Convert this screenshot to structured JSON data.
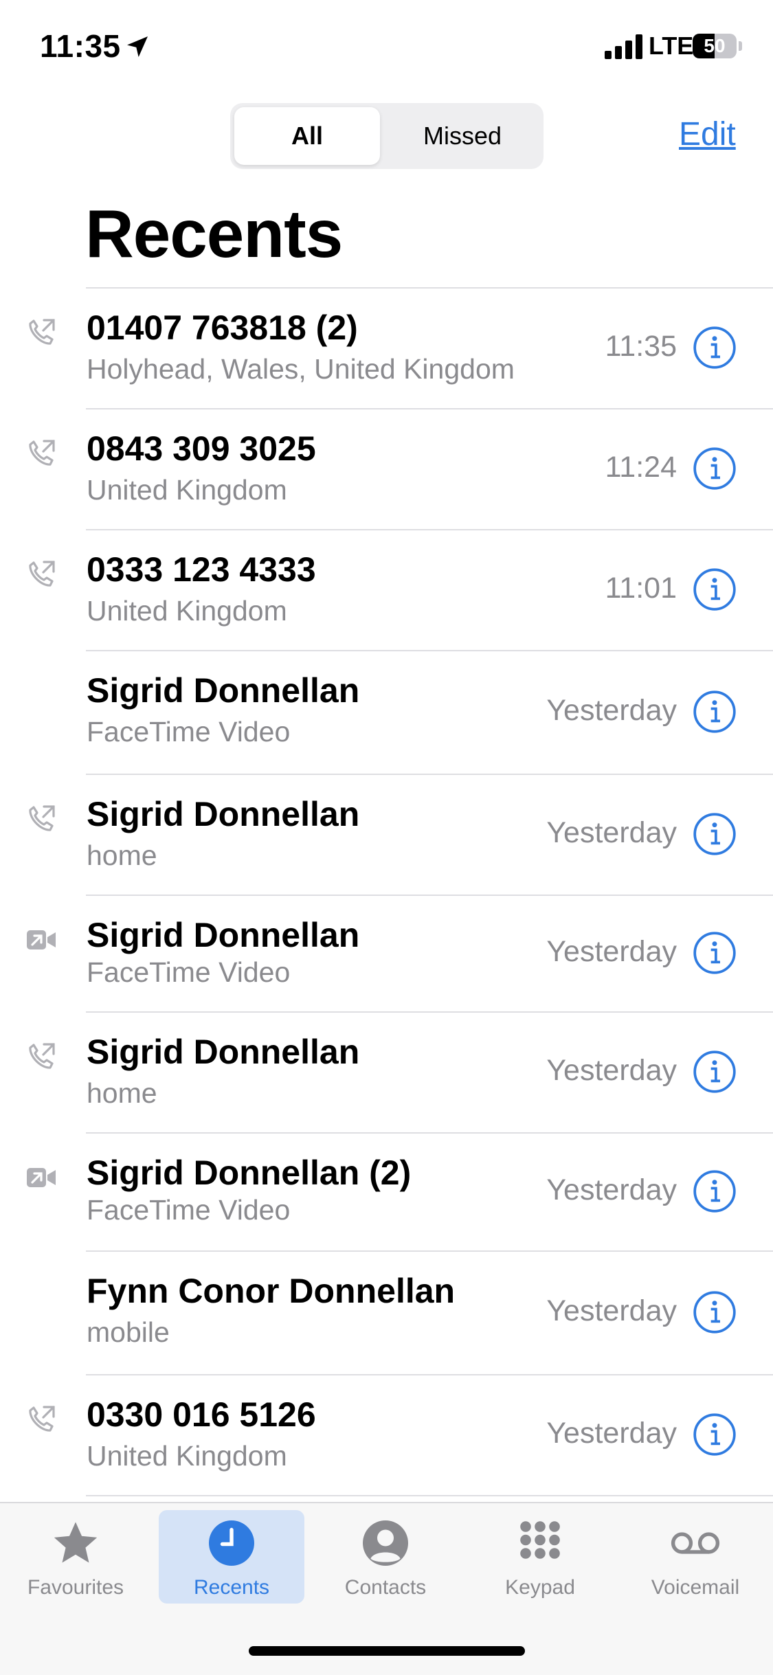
{
  "status_bar": {
    "time": "11:35",
    "network": "LTE",
    "battery": "50",
    "battery_level": 0.5
  },
  "segments": {
    "all": "All",
    "missed": "Missed",
    "selected": "All"
  },
  "edit_label": "Edit",
  "title": "Recents",
  "colors": {
    "accent": "#2f7be0",
    "secondary_text": "#8a8a8e",
    "divider": "#dedee2"
  },
  "calls": [
    {
      "icon": "outgoing-call-icon",
      "name": "01407 763818 (2)",
      "sub": "Holyhead, Wales, United Kingdom",
      "time": "11:35"
    },
    {
      "icon": "outgoing-call-icon",
      "name": "0843 309 3025",
      "sub": "United Kingdom",
      "time": "11:24"
    },
    {
      "icon": "outgoing-call-icon",
      "name": "0333 123 4333",
      "sub": "United Kingdom",
      "time": "11:01"
    },
    {
      "icon": "",
      "name": "Sigrid Donnellan",
      "sub": "FaceTime Video",
      "time": "Yesterday"
    },
    {
      "icon": "outgoing-call-icon",
      "name": "Sigrid Donnellan",
      "sub": "home",
      "time": "Yesterday"
    },
    {
      "icon": "outgoing-video-icon",
      "name": "Sigrid Donnellan",
      "sub": "FaceTime Video",
      "time": "Yesterday"
    },
    {
      "icon": "outgoing-call-icon",
      "name": "Sigrid Donnellan",
      "sub": "home",
      "time": "Yesterday"
    },
    {
      "icon": "outgoing-video-icon",
      "name": "Sigrid Donnellan (2)",
      "sub": "FaceTime Video",
      "time": "Yesterday"
    },
    {
      "icon": "",
      "name": "Fynn Conor Donnellan",
      "sub": "mobile",
      "time": "Yesterday"
    },
    {
      "icon": "outgoing-call-icon",
      "name": "0330 016 5126",
      "sub": "United Kingdom",
      "time": "Yesterday"
    }
  ],
  "tabs": [
    {
      "label": "Favourites",
      "icon": "star-icon"
    },
    {
      "label": "Recents",
      "icon": "clock-icon",
      "active": true
    },
    {
      "label": "Contacts",
      "icon": "person-icon"
    },
    {
      "label": "Keypad",
      "icon": "keypad-icon"
    },
    {
      "label": "Voicemail",
      "icon": "voicemail-icon"
    }
  ]
}
